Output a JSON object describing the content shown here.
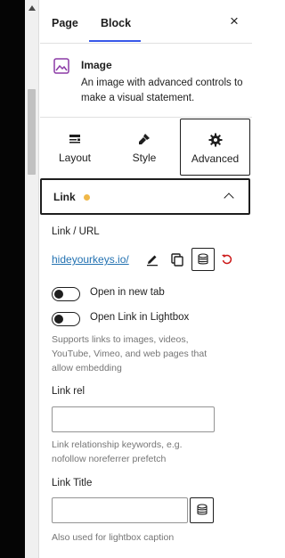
{
  "tabs": {
    "page": "Page",
    "block": "Block",
    "close": "×"
  },
  "block": {
    "name": "Image",
    "description": "An image with advanced controls to make a visual statement."
  },
  "inspector_tabs": [
    {
      "label": "Layout",
      "icon": "layout-icon"
    },
    {
      "label": "Style",
      "icon": "style-brush-icon"
    },
    {
      "label": "Advanced",
      "icon": "gear-icon",
      "active": true
    }
  ],
  "link_section": {
    "title": "Link",
    "indicator_color": "#f0b849",
    "url_label": "Link / URL",
    "url_value": "hideyourkeys.io/",
    "toggle_new_tab": "Open in new tab",
    "toggle_lightbox": "Open Link in Lightbox",
    "lightbox_help": "Supports links to images, videos, YouTube, Vimeo, and web pages that allow embedding",
    "rel_label": "Link rel",
    "rel_value": "",
    "rel_help": "Link relationship keywords, e.g. nofollow noreferrer prefetch",
    "title_label": "Link Title",
    "title_value": "",
    "title_help": "Also used for lightbox caption"
  },
  "colors": {
    "accent": "#3858e9",
    "link": "#2271b1",
    "reset": "#cc1818",
    "block_icon": "#8b3aa6"
  }
}
